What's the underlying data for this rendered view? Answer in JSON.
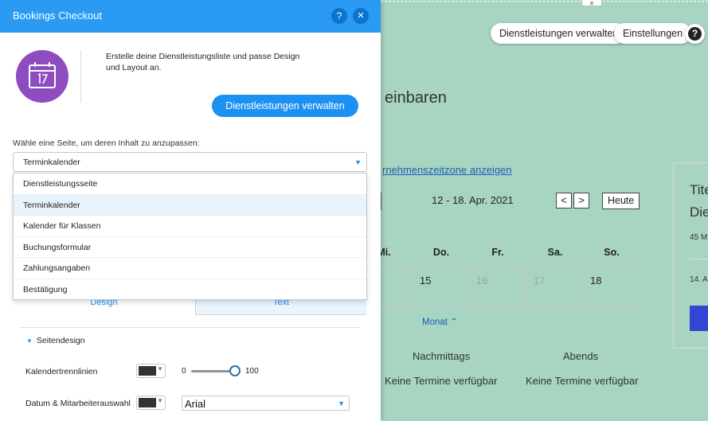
{
  "panel": {
    "title": "Bookings Checkout",
    "help_glyph": "?",
    "close_glyph": "×",
    "hero_text": "Erstelle deine Dienstleistungsliste und passe Design und Layout an.",
    "manage_button": "Dienstleistungen verwalten",
    "page_select_label": "Wähle eine Seite, um deren Inhalt zu anzupassen:",
    "page_select_value": "Terminkalender",
    "page_options": [
      "Dienstleistungsseite",
      "Terminkalender",
      "Kalender für Klassen",
      "Buchungsformular",
      "Zahlungsangaben",
      "Bestätigung"
    ],
    "tabs": [
      "Design",
      "Text"
    ],
    "section_title": "Seitendesign",
    "rows": {
      "separator_label": "Kalendertrennlinien",
      "slider_min": "0",
      "slider_max": "100",
      "slider_value": 100,
      "date_label": "Datum & Mitarbeiterauswahl",
      "font_value": "Arial"
    },
    "colors": {
      "header": "#2b9af3",
      "accent": "#1d91f2",
      "icon_circle": "#8e4cc1",
      "swatch": "#333333"
    }
  },
  "site": {
    "top_buttons": [
      "Dienstleistungen verwalten",
      "Einstellungen"
    ],
    "help_glyph": "?",
    "heading_fragment": "einbaren",
    "timezone_link": "rnehmenszeitzone anzeigen",
    "week_range": "12 - 18. Apr. 2021",
    "nav_prev": "<",
    "nav_next": ">",
    "today_button": "Heute",
    "day_headers": [
      "Mi.",
      "Do.",
      "Fr.",
      "Sa.",
      "So."
    ],
    "day_numbers": [
      "15",
      "16",
      "17",
      "18"
    ],
    "month_toggle": "Monat",
    "slots": [
      {
        "title": "Nachmittags",
        "status": "Keine Termine verfügbar"
      },
      {
        "title": "Abends",
        "status": "Keine Termine verfügbar"
      }
    ],
    "card": {
      "title_line1": "Tite",
      "title_line2": "Die",
      "duration": "45 M",
      "date": "14. A"
    },
    "colors": {
      "background": "#a8d5c2",
      "link": "#1a5fb4",
      "card_button": "#3346d3"
    }
  }
}
